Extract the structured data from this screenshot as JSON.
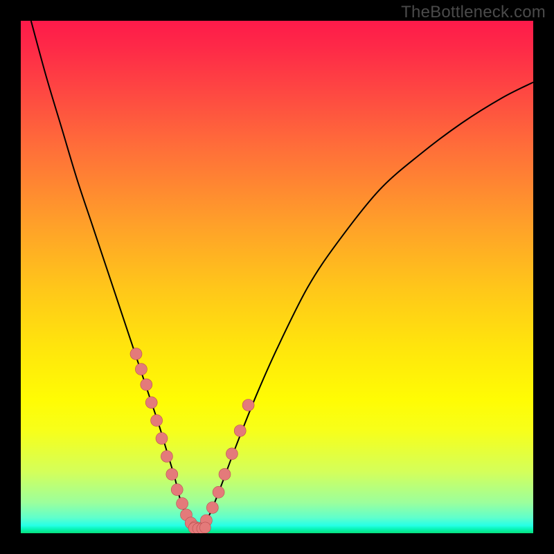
{
  "watermark": {
    "text": "TheBottleneck.com"
  },
  "colors": {
    "frame": "#000000",
    "curve_stroke": "#000000",
    "dot_fill": "#e47a7a",
    "dot_stroke": "#b84f4f"
  },
  "chart_data": {
    "type": "line",
    "title": "",
    "xlabel": "",
    "ylabel": "",
    "xlim": [
      0,
      100
    ],
    "ylim": [
      0,
      100
    ],
    "series": [
      {
        "name": "bottleneck-curve",
        "x": [
          2,
          5,
          8,
          11,
          14,
          17,
          19,
          21,
          23,
          25,
          27,
          28.5,
          30,
          31,
          32,
          33,
          34,
          35.5,
          37,
          39,
          42,
          46,
          50,
          56,
          62,
          70,
          78,
          86,
          94,
          100
        ],
        "y": [
          100,
          89,
          79,
          69,
          60,
          51,
          45,
          39,
          33,
          27,
          21,
          16,
          11,
          7,
          4,
          1.5,
          0.8,
          1.5,
          4,
          9,
          17,
          27,
          36,
          48,
          57,
          67,
          74,
          80,
          85,
          88
        ]
      }
    ],
    "dots_left": {
      "x": [
        22.5,
        23.5,
        24.5,
        25.5,
        26.5,
        27.5,
        28.5,
        29.5,
        30.5,
        31.5,
        32.3,
        33.2,
        34.0,
        34.8
      ],
      "y": [
        35,
        32,
        29,
        25.5,
        22,
        18.5,
        15,
        11.5,
        8.5,
        5.8,
        3.6,
        2.0,
        1.2,
        1.0
      ]
    },
    "dots_right": {
      "x": [
        36.2,
        37.4,
        38.6,
        39.8,
        41.2,
        42.8,
        44.4
      ],
      "y": [
        2.5,
        5.0,
        8.0,
        11.5,
        15.5,
        20.0,
        25.0
      ]
    },
    "flat_dots": {
      "x": [
        33.8,
        34.6,
        35.4,
        36.0
      ],
      "y": [
        1.0,
        0.9,
        0.9,
        1.1
      ]
    }
  }
}
